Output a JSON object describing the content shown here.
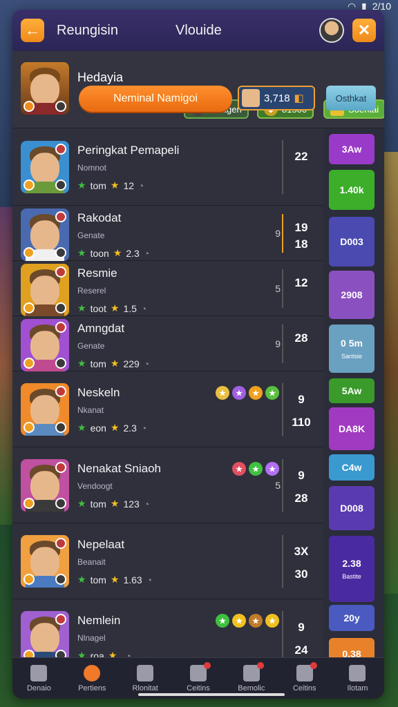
{
  "status": {
    "time": "2/10"
  },
  "header": {
    "title": "Reungisin",
    "subtitle": "Vlouide",
    "back_icon": "arrow-left-icon",
    "close_icon": "close-icon"
  },
  "profile": {
    "name": "Hedayia",
    "chips": [
      "Bolagen",
      "81500",
      "Soentai"
    ],
    "primary_button": "Neminal Namigoi",
    "score": "3,718",
    "secondary_button": "Osthkat"
  },
  "players": [
    {
      "name": "Peringkat Pemapeli",
      "sub": "Nomnot",
      "stat_label": "tom",
      "stat_value": "12",
      "rank": "",
      "score": "22",
      "score2": "",
      "avatar_bg": "#3a8fd0",
      "shirt": "#6a9a3a"
    },
    {
      "name": "Rakodat",
      "sub": "Genate",
      "stat_label": "toon",
      "stat_value": "2.3",
      "rank": "9",
      "score": "19",
      "score2": "18",
      "avatar_bg": "#4a6ab0",
      "shirt": "#f0f0f0"
    },
    {
      "name": "Resmie",
      "sub": "Reserel",
      "stat_label": "toot",
      "stat_value": "1.5",
      "rank": "5",
      "score": "12",
      "score2": "",
      "avatar_bg": "#e0a020",
      "shirt": "#7a4a2a"
    },
    {
      "name": "Amngdat",
      "sub": "Genate",
      "stat_label": "tom",
      "stat_value": "229",
      "rank": "9",
      "score": "28",
      "score2": "",
      "avatar_bg": "#a050d0",
      "shirt": "#c04a90"
    },
    {
      "name": "Neskeln",
      "sub": "Nkanat",
      "stat_label": "eon",
      "stat_value": "2.3",
      "rank": "",
      "score": "9",
      "score2": "110",
      "avatar_bg": "#f08a2a",
      "shirt": "#5a8ac0"
    },
    {
      "name": "Nenakat Sniaoh",
      "sub": "Vendoogt",
      "stat_label": "tom",
      "stat_value": "123",
      "rank": "5",
      "score": "9",
      "score2": "28",
      "avatar_bg": "#c050a0",
      "shirt": "#3a3a3a"
    },
    {
      "name": "Nepelaat",
      "sub": "Beanait",
      "stat_label": "tom",
      "stat_value": "1.63",
      "rank": "",
      "score": "3X",
      "score2": "30",
      "avatar_bg": "#f0a040",
      "shirt": "#4a7ac0"
    },
    {
      "name": "Nemlein",
      "sub": "Nlnagel",
      "stat_label": "roa",
      "stat_value": "",
      "rank": "",
      "score": "9",
      "score2": "24",
      "avatar_bg": "#a060d0",
      "shirt": "#2a4a7a"
    }
  ],
  "side_cards": [
    {
      "label": "3Aw",
      "sub": "",
      "color": "#9a3ac8"
    },
    {
      "label": "1.40k",
      "sub": "",
      "color": "#3cae2a"
    },
    {
      "label": "D003",
      "sub": "",
      "color": "#4a4ab0"
    },
    {
      "label": "2908",
      "sub": "",
      "color": "#8a50c0"
    },
    {
      "label": "0 5m",
      "sub": "Santsie",
      "color": "#6aa0c0"
    },
    {
      "label": "5Aw",
      "sub": "",
      "color": "#3a9a2a"
    },
    {
      "label": "DA8K",
      "sub": "",
      "color": "#a03ac0"
    },
    {
      "label": "C4w",
      "sub": "",
      "color": "#3a9ad0"
    },
    {
      "label": "D008",
      "sub": "",
      "color": "#5a3ab0"
    },
    {
      "label": "2.38",
      "sub": "Bastite",
      "color": "#4a2aa0"
    },
    {
      "label": "20y",
      "sub": "",
      "color": "#4a5ac0"
    },
    {
      "label": "0.38",
      "sub": "",
      "color": "#e8822a"
    }
  ],
  "tabs": [
    {
      "label": "Denaio",
      "icon": "home-icon"
    },
    {
      "label": "Pertiens",
      "icon": "medal-icon"
    },
    {
      "label": "Rlonitat",
      "icon": "inbox-icon"
    },
    {
      "label": "Ceitins",
      "icon": "shield-icon"
    },
    {
      "label": "Bemolic",
      "icon": "chat-icon"
    },
    {
      "label": "Ceitins",
      "icon": "puzzle-icon"
    },
    {
      "label": "Ilotam",
      "icon": "team-icon"
    }
  ]
}
